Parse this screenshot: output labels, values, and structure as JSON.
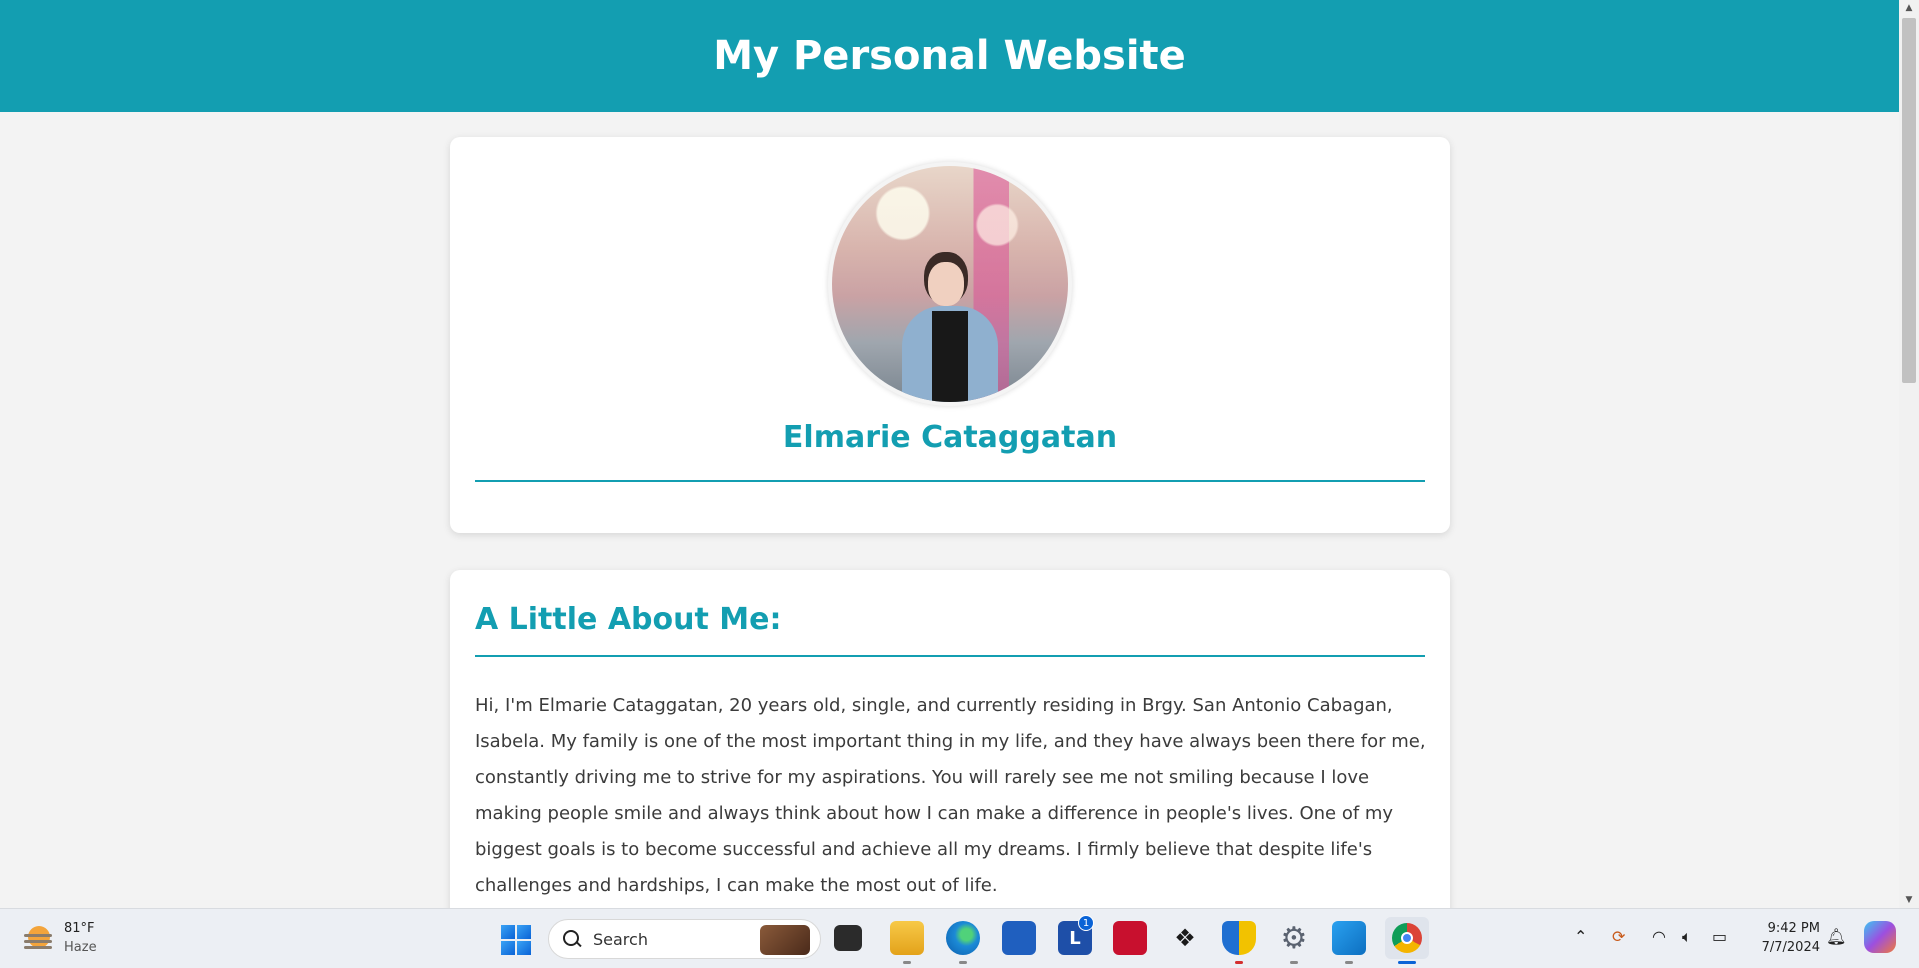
{
  "site": {
    "title": "My Personal Website"
  },
  "profile": {
    "name": "Elmarie Cataggatan",
    "avatar_alt": "profile-photo"
  },
  "about": {
    "heading": "A Little About Me:",
    "text": "Hi, I'm Elmarie Cataggatan, 20 years old, single, and currently residing in Brgy. San Antonio Cabagan, Isabela. My family is one of the most important thing in my life, and they have always been there for me, constantly driving me to strive for my aspirations. You will rarely see me not smiling because I love making people smile and always think about how I can make a difference in people's lives. One of my biggest goals is to become successful and achieve all my dreams. I firmly believe that despite life's challenges and hardships, I can make the most out of life."
  },
  "colors": {
    "accent": "#139eb1",
    "background": "#f3f3f3",
    "card": "#ffffff",
    "text": "#3b3b3b"
  },
  "taskbar": {
    "weather": {
      "temp": "81°F",
      "condition": "Haze"
    },
    "search_placeholder": "Search",
    "apps": [
      {
        "name": "task-view",
        "icon": "task-view-icon"
      },
      {
        "name": "file-explorer",
        "icon": "folder-icon"
      },
      {
        "name": "edge",
        "icon": "edge-icon"
      },
      {
        "name": "microsoft-store",
        "icon": "store-icon"
      },
      {
        "name": "l-app",
        "icon": "l-app-icon",
        "badge": "1"
      },
      {
        "name": "mcafee",
        "icon": "mcafee-icon"
      },
      {
        "name": "dropbox",
        "icon": "dropbox-icon"
      },
      {
        "name": "security",
        "icon": "shield-icon"
      },
      {
        "name": "settings",
        "icon": "gear-icon"
      },
      {
        "name": "vscode",
        "icon": "vscode-icon"
      },
      {
        "name": "chrome",
        "icon": "chrome-icon"
      }
    ],
    "l_app_letter": "L",
    "l_app_badge": "1",
    "clock": {
      "time": "9:42 PM",
      "date": "7/7/2024"
    }
  }
}
